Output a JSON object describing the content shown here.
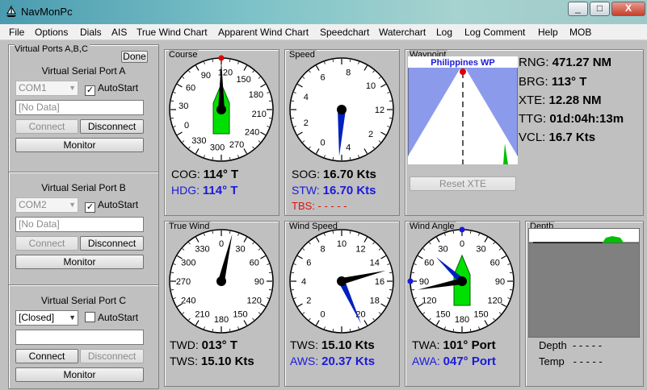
{
  "window": {
    "title": "NavMonPc",
    "min": "_",
    "max": "□",
    "close": "X"
  },
  "menu": [
    "File",
    "Options",
    "Dials",
    "AIS",
    "True Wind Chart",
    "Apparent Wind Chart",
    "Speedchart",
    "Waterchart",
    "Log",
    "Log Comment",
    "Help",
    "MOB"
  ],
  "ports": {
    "title": "Virtual Ports A,B,C",
    "done_label": "Done",
    "list": [
      {
        "name": "Virtual Serial Port A",
        "combo": "COM1",
        "autostart_label": "AutoStart",
        "autostart": true,
        "data_text": "[No Data]",
        "connect": "Connect",
        "disconnect": "Disconnect",
        "monitor": "Monitor",
        "enabled": false
      },
      {
        "name": "Virtual Serial Port B",
        "combo": "COM2",
        "autostart_label": "AutoStart",
        "autostart": true,
        "data_text": "[No Data]",
        "connect": "Connect",
        "disconnect": "Disconnect",
        "monitor": "Monitor",
        "enabled": false
      },
      {
        "name": "Virtual Serial Port C",
        "combo": "[Closed]",
        "autostart_label": "AutoStart",
        "autostart": false,
        "data_text": "",
        "connect": "Connect",
        "disconnect": "Disconnect",
        "monitor": "Monitor",
        "enabled": true
      }
    ]
  },
  "course": {
    "label": "Course",
    "ticks": [
      "120",
      "150",
      "180",
      "210",
      "240",
      "270",
      "300",
      "330",
      "0",
      "30",
      "60",
      "90"
    ],
    "cog_label": "COG:",
    "cog": "114° T",
    "hdg_label": "HDG:",
    "hdg": "114° T",
    "cog_deg": 114,
    "hdg_deg": 114
  },
  "speed": {
    "label": "Speed",
    "ticks": [
      "0",
      "2",
      "4",
      "6",
      "8",
      "10",
      "12",
      "2",
      "4"
    ],
    "sog_label": "SOG:",
    "sog": "16.70 Kts",
    "stw_label": "STW:",
    "stw": "16.70 Kts",
    "tbs_label": "TBS:",
    "tbs": "- - - - -",
    "needle_kts": 16.7
  },
  "waypoint": {
    "label": "Waypoint",
    "name": "Philippines WP",
    "rng_label": "RNG:",
    "rng": "471.27 NM",
    "brg_label": "BRG:",
    "brg": "113° T",
    "xte_label": "XTE:",
    "xte": "12.28 NM",
    "ttg_label": "TTG:",
    "ttg": "01d:04h:13m",
    "vcl_label": "VCL:",
    "vcl": "16.7 Kts",
    "reset_label": "Reset XTE"
  },
  "true_wind": {
    "label": "True Wind",
    "ticks": [
      "0",
      "30",
      "60",
      "90",
      "120",
      "150",
      "180",
      "210",
      "240",
      "270",
      "300",
      "330"
    ],
    "twd_label": "TWD:",
    "twd": "013° T",
    "tws_label": "TWS:",
    "tws": "15.10 Kts",
    "twd_deg": 13
  },
  "wind_speed": {
    "label": "Wind Speed",
    "ticks": [
      "0",
      "2",
      "4",
      "6",
      "8",
      "10",
      "12",
      "14",
      "16",
      "18",
      "20"
    ],
    "tws_label": "TWS:",
    "tws": "15.10 Kts",
    "aws_label": "AWS:",
    "aws": "20.37 Kts",
    "tws_kts": 15.1,
    "aws_kts": 20.37
  },
  "wind_angle": {
    "label": "Wind Angle",
    "ticks": [
      "0",
      "30",
      "60",
      "90",
      "120",
      "150",
      "180",
      "150",
      "120",
      "90",
      "60",
      "30"
    ],
    "twa_label": "TWA:",
    "twa": "101° Port",
    "awa_label": "AWA:",
    "awa": "047° Port",
    "twa_deg": 101,
    "awa_deg": 47
  },
  "depth": {
    "label": "Depth",
    "depth_label": "Depth",
    "depth": "- - - - -",
    "temp_label": "Temp",
    "temp": "- - - - -"
  },
  "colors": {
    "hull": "#00e000",
    "accent_red": "#e00000",
    "blue": "#1a1adc",
    "needle": "#000000"
  }
}
